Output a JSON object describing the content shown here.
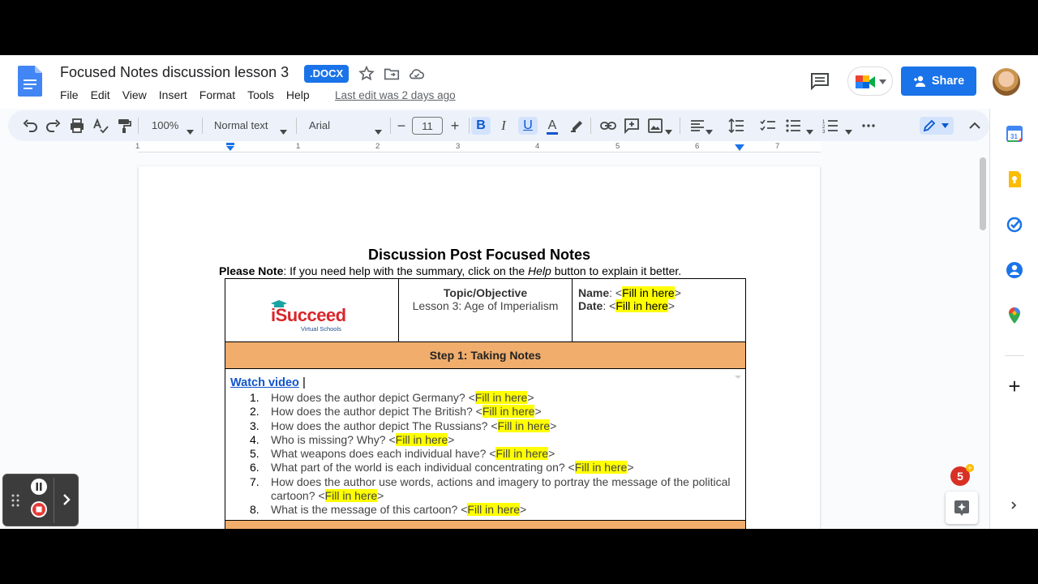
{
  "header": {
    "doc_title": "Focused Notes discussion lesson 3",
    "format_badge": ".DOCX",
    "menu": [
      "File",
      "Edit",
      "View",
      "Insert",
      "Format",
      "Tools",
      "Help"
    ],
    "last_edit": "Last edit was 2 days ago",
    "share_label": "Share"
  },
  "toolbar": {
    "zoom": "100%",
    "style": "Normal text",
    "font": "Arial",
    "font_size": "11"
  },
  "ruler": {
    "marks": [
      "1",
      "1",
      "2",
      "3",
      "4",
      "5",
      "6",
      "7"
    ]
  },
  "document": {
    "heading": "Discussion Post Focused Notes",
    "note_label": "Please Note",
    "note_text_1": ": If you need help with the summary, click on the ",
    "note_italic": "Help",
    "note_text_2": " button to explain it better.",
    "logo_main": "iSucceed",
    "logo_sub": "Virtual Schools",
    "topic_header": "Topic/Objective",
    "topic_value": "Lesson 3: Age of Imperialism",
    "name_label": "Name",
    "date_label": "Date",
    "fill_text": "Fill in here",
    "step1": "Step 1: Taking Notes",
    "watch_video": "Watch video",
    "questions": [
      {
        "num": "1.",
        "text": "How does the author depict Germany? <",
        "after": ">"
      },
      {
        "num": "2.",
        "text": "How does the author depict The British? <",
        "after": ">"
      },
      {
        "num": "3.",
        "text": "How does the author depict The Russians? <",
        "after": ">"
      },
      {
        "num": "4.",
        "text": "Who is missing? Why? <",
        "after": ">"
      },
      {
        "num": "5.",
        "text": "What weapons does each individual have? <",
        "after": ">"
      },
      {
        "num": "6.",
        "text": "What part of the world is each individual concentrating on? <",
        "after": ">"
      },
      {
        "num": "7.",
        "text": "How does the author use words, actions and imagery to portray the message of the political cartoon? <",
        "after": ">"
      },
      {
        "num": "8.",
        "text": "What is the message of this cartoon? <",
        "after": ">"
      }
    ]
  },
  "notifications": {
    "count": "5"
  },
  "colors": {
    "accent": "#1a73e8",
    "highlight": "#ffff00",
    "step_bar": "#f0ad6c"
  }
}
